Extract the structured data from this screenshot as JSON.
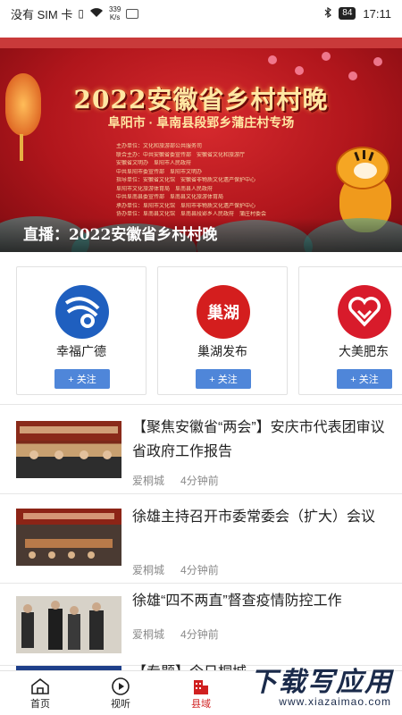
{
  "status_bar": {
    "carrier": "没有 SIM 卡",
    "speed_value": "339",
    "speed_unit": "K/s",
    "battery": "84",
    "time": "17:11"
  },
  "banner": {
    "title": "2022安徽省乡村村晚",
    "subtitle": "阜阳市 · 阜南县段郢乡蒲庄村专场",
    "credits": [
      "主办单位：文化和旅游部公共服务司",
      "联合主办：中共安徽省委宣传部　安徽省文化和旅游厅",
      "安徽省文明办　阜阳市人民政府",
      "中共阜阳市委宣传部　阜阳市文明办",
      "指导单位：安徽省文化馆　安徽省非物质文化遗产保护中心",
      "阜阳市文化旅游体育局　阜南县人民政府",
      "中共阜南县委宣传部　阜南县文化旅游体育局",
      "承办单位：阜阳市文化馆　阜阳市非物质文化遗产保护中心",
      "协办单位：阜南县文化馆　阜南县段郢乡人民政府　蒲庄村委会"
    ],
    "caption": "直播：2022安徽省乡村村晚"
  },
  "accounts": [
    {
      "name": "幸福广德",
      "follow_label": "+ 关注",
      "logo_text": "",
      "color": "#1f5fbf"
    },
    {
      "name": "巢湖发布",
      "follow_label": "+ 关注",
      "logo_text": "巢湖",
      "color": "#d41e1e"
    },
    {
      "name": "大美肥东",
      "follow_label": "+ 关注",
      "logo_text": "",
      "color": "#d81b2b"
    }
  ],
  "news": [
    {
      "title": "【聚焦安徽省“两会”】安庆市代表团审议省政府工作报告",
      "source": "爱桐城",
      "time": "4分钟前"
    },
    {
      "title": "徐雄主持召开市委常委会（扩大）会议",
      "source": "爱桐城",
      "time": "4分钟前"
    },
    {
      "title": "徐雄“四不两直”督查疫情防控工作",
      "source": "爱桐城",
      "time": "4分钟前"
    },
    {
      "title": "【专题】今日桐城",
      "source": "",
      "time": ""
    }
  ],
  "bottom_nav": [
    {
      "label": "首页",
      "icon": "home-icon"
    },
    {
      "label": "视听",
      "icon": "play-icon"
    },
    {
      "label": "县域",
      "icon": "building-icon",
      "active": true
    },
    {
      "label": "",
      "icon": ""
    },
    {
      "label": "",
      "icon": ""
    }
  ],
  "watermark": {
    "main": "下载写应用",
    "url": "www.xiazaimao.com"
  },
  "colors": {
    "accent_red": "#d02020",
    "follow_blue": "#4f86d9"
  }
}
